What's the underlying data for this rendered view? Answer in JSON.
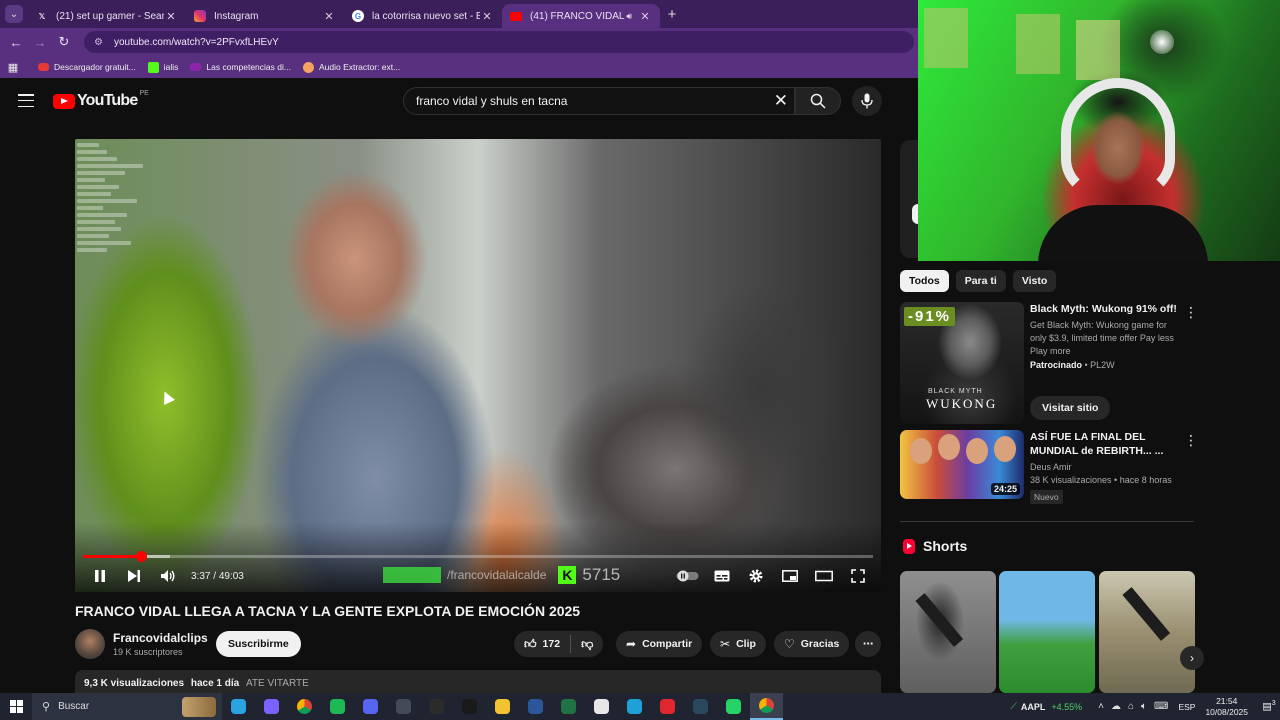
{
  "browser": {
    "tabs": [
      {
        "label": "(21) set up gamer - Search / X",
        "icon": "x-logo-icon",
        "active": false
      },
      {
        "label": "Instagram",
        "icon": "instagram-icon",
        "active": false
      },
      {
        "label": "la cotorrisa nuevo set - Buscar",
        "icon": "google-icon",
        "active": false
      },
      {
        "label": "(41) FRANCO VIDAL LLEGA",
        "icon": "youtube-icon",
        "active": true
      }
    ],
    "url": "youtube.com/watch?v=2PFvxfLHEvY",
    "bookmarks": [
      {
        "label": "Descargador gratuit...",
        "color": "#e53935"
      },
      {
        "label": "ialis",
        "color": "#53fc18"
      },
      {
        "label": "Las competencias di...",
        "color": "#8e24aa"
      },
      {
        "label": "Audio Extractor: ext...",
        "color": "#f4a261"
      }
    ]
  },
  "youtube": {
    "logo": "YouTube",
    "country": "PE",
    "search_query": "franco vidal y shuls en tacna"
  },
  "player": {
    "time_current": "3:37",
    "time_total": "49:03",
    "progress_fraction": 0.074,
    "loaded_fraction": 0.11,
    "overlay_handle": "/francovidalalcalde",
    "overlay_viewers": "5715"
  },
  "video": {
    "title": "FRANCO VIDAL LLEGA A TACNA Y LA GENTE EXPLOTA DE EMOCIÓN 2025",
    "channel": "Francovidalclips",
    "subscribers": "19 K suscriptores",
    "subscribe_label": "Suscribirme",
    "likes": "172",
    "share_label": "Compartir",
    "clip_label": "Clip",
    "thanks_label": "Gracias",
    "views": "9,3 K visualizaciones",
    "age": "hace 1 día",
    "tag": "ATE VITARTE"
  },
  "sidebar": {
    "chips": [
      "Todos",
      "Para ti",
      "Visto"
    ],
    "ad": {
      "title": "Black Myth: Wukong 91% off!",
      "description": "Get Black Myth: Wukong game for only $3.9, limited time offer Pay less Play more",
      "sponsored": "Patrocinado",
      "advertiser": "PL2W",
      "cta": "Visitar sitio",
      "thumb_badge": "-91%",
      "thumb_subtitle": "BLACK MYTH",
      "thumb_title": "WUKONG"
    },
    "recommended": {
      "title": "ASÍ FUE LA FINAL DEL MUNDIAL de REBIRTH... ...",
      "channel": "Deus Amir",
      "stats": "38 K visualizaciones • hace 8 horas",
      "badge": "Nuevo",
      "duration": "24:25"
    },
    "shorts_title": "Shorts"
  },
  "taskbar": {
    "search_label": "Buscar",
    "stock_symbol": "AAPL",
    "stock_change": "+4.55%",
    "language": "ESP",
    "time": "21:54",
    "date": "10/08/2025",
    "notifications": "3",
    "apps": [
      {
        "name": "telegram-icon",
        "color": "#2aa3e0"
      },
      {
        "name": "copilot-icon",
        "color": "#7b61ff"
      },
      {
        "name": "chrome-icon",
        "color": "#e8b422"
      },
      {
        "name": "spotify-icon",
        "color": "#1db954"
      },
      {
        "name": "discord-icon",
        "color": "#5865f2"
      },
      {
        "name": "obs-icon",
        "color": "#444a58"
      },
      {
        "name": "epic-games-icon",
        "color": "#2b2b2b"
      },
      {
        "name": "capcut-icon",
        "color": "#1a1a1a"
      },
      {
        "name": "file-explorer-icon",
        "color": "#f2c230"
      },
      {
        "name": "word-icon",
        "color": "#2b579a"
      },
      {
        "name": "excel-icon",
        "color": "#217346"
      },
      {
        "name": "file-icon",
        "color": "#e6e6e6"
      },
      {
        "name": "edge-icon",
        "color": "#1fa0d6"
      },
      {
        "name": "opera-gx-icon",
        "color": "#e0262e"
      },
      {
        "name": "steam-icon",
        "color": "#2a475e"
      },
      {
        "name": "whatsapp-icon",
        "color": "#25d366"
      },
      {
        "name": "chrome-active-icon",
        "color": "#e8b422"
      }
    ]
  }
}
